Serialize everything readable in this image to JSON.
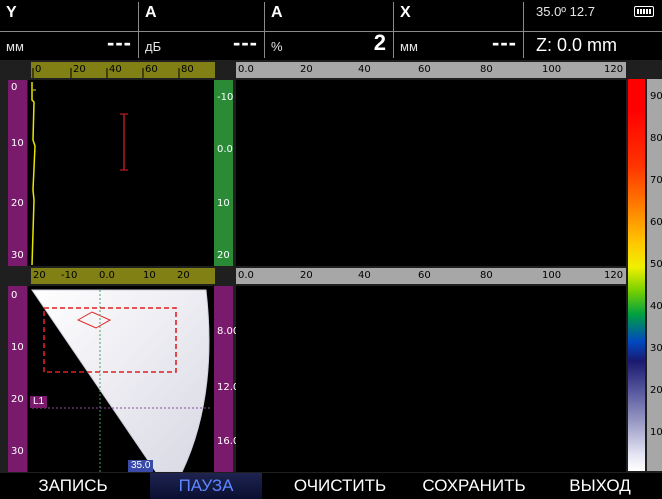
{
  "readouts": [
    {
      "name": "Y",
      "unit": "мм",
      "value": "---"
    },
    {
      "name": "A",
      "unit": "дБ",
      "value": "---"
    },
    {
      "name": "A",
      "unit": "%",
      "value": "2"
    },
    {
      "name": "X",
      "unit": "мм",
      "value": "---"
    }
  ],
  "status": {
    "angle": "35.0º 12.7",
    "z": "Z: 0.0 mm"
  },
  "icons": {
    "battery": "battery-icon"
  },
  "rulers": {
    "top_left_h": [
      "0",
      "20",
      "40",
      "60",
      "80"
    ],
    "top_main_h": [
      "0.0",
      "20",
      "40",
      "60",
      "80",
      "100",
      "120"
    ],
    "left_v_top": [
      "0",
      "10",
      "20",
      "30"
    ],
    "mid_v_top": [
      "-10",
      "0.0",
      "10",
      "20"
    ],
    "lower_left_h": [
      "20",
      "-10",
      "0.0",
      "10",
      "20"
    ],
    "lower_main_h": [
      "0.0",
      "20",
      "40",
      "60",
      "80",
      "100",
      "120"
    ],
    "left_v_bottom": [
      "0",
      "10",
      "20",
      "30"
    ],
    "mid_v_bottom": [
      "8.00",
      "12.0",
      "16.0"
    ],
    "color_scale": [
      "90",
      "80",
      "70",
      "60",
      "50",
      "40",
      "30",
      "20",
      "10"
    ]
  },
  "tags": {
    "layer": "L1",
    "angle_value": "35.0"
  },
  "softkeys": [
    {
      "label": "ЗАПИСЬ",
      "active": false
    },
    {
      "label": "ПАУЗА",
      "active": true
    },
    {
      "label": "ОЧИСТИТЬ",
      "active": false
    },
    {
      "label": "СОХРАНИТЬ",
      "active": false
    },
    {
      "label": "ВЫХОД",
      "active": false
    }
  ],
  "colors": {
    "accent": "#5e87ff",
    "olive": "#808015",
    "purple": "#7a1a6c",
    "green": "#2a8a36",
    "gate": "#e02020"
  }
}
